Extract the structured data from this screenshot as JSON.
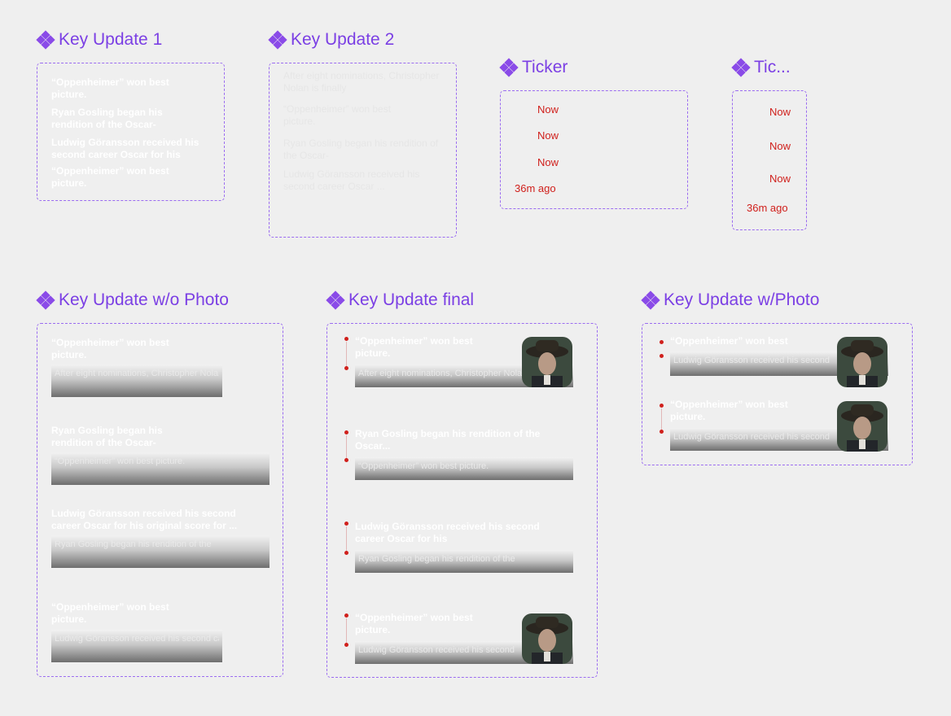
{
  "titles": {
    "key_update_1": "Key Update 1",
    "key_update_2": "Key Update 2",
    "ticker": "Ticker",
    "ticker_small": "Tic...",
    "key_update_wo_photo": "Key Update w/o Photo",
    "key_update_final": "Key Update final",
    "key_update_w_photo": "Key Update w/Photo"
  },
  "key_update_1": {
    "items": [
      "“Oppenheimer” won best picture.",
      "Ryan Gosling began his rendition of the Oscar-",
      "Ludwig Göransson received his second career Oscar for his",
      "“Oppenheimer” won best picture."
    ]
  },
  "key_update_2": {
    "items": [
      "After eight nominations, Christopher Nolan is finally",
      "“Oppenheimer” won best picture.",
      "Ryan Gosling began his rendition of the Oscar-",
      "Ludwig Göransson received his second career Oscar ..."
    ]
  },
  "ticker": {
    "items": [
      "Now",
      "Now",
      "Now",
      "36m ago"
    ]
  },
  "ticker_small": {
    "items": [
      "Now",
      "Now",
      "Now",
      "36m ago"
    ]
  },
  "key_update_wo_photo": {
    "items": [
      {
        "headline": "“Oppenheimer” won best picture.",
        "sub": "After eight nominations, Christopher Nolan is finally"
      },
      {
        "headline": "Ryan Gosling began his rendition of the Oscar-",
        "sub": "“Oppenheimer” won best picture."
      },
      {
        "headline": "Ludwig Göransson received his second career Oscar for his original score for ...",
        "sub": "Ryan Gosling began his rendition of the"
      },
      {
        "headline": "“Oppenheimer” won best picture.",
        "sub": "Ludwig Göransson received his second career Oscar"
      }
    ]
  },
  "key_update_final": {
    "items": [
      {
        "headline": "“Oppenheimer” won best picture.",
        "sub": "After eight nominations, Christopher Nolan"
      },
      {
        "headline": "Ryan Gosling began his rendition of the Oscar...",
        "sub": "“Oppenheimer” won best picture."
      },
      {
        "headline": "Ludwig Göransson received his second career Oscar for his",
        "sub": "Ryan Gosling began his rendition of the"
      },
      {
        "headline": "“Oppenheimer” won best picture.",
        "sub": "Ludwig Göransson received his second"
      }
    ]
  },
  "key_update_w_photo": {
    "items": [
      {
        "headline": "“Oppenheimer” won best",
        "sub": "Ludwig Göransson received his second"
      },
      {
        "headline": "“Oppenheimer” won best picture.",
        "sub": "Ludwig Göransson received his second"
      }
    ]
  },
  "colors": {
    "accent": "#7b3fe4",
    "ticker_red": "#d0201c",
    "background": "#efefef"
  }
}
